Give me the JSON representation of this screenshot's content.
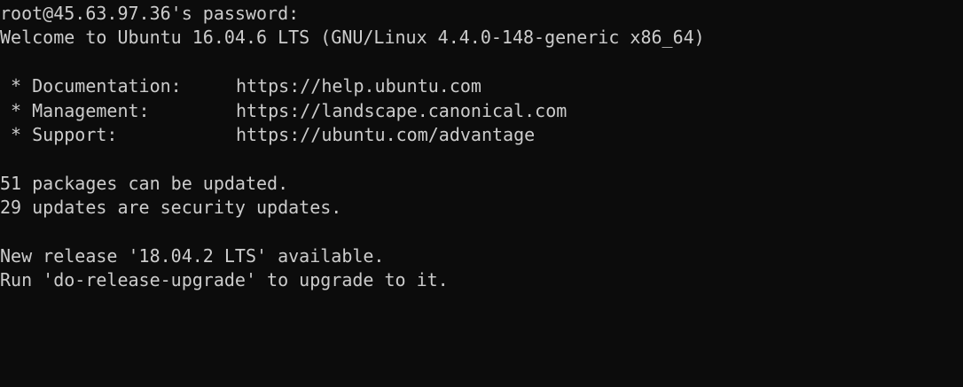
{
  "terminal": {
    "colors": {
      "background": "#0c0c0c",
      "foreground": "#cccccc"
    },
    "prompt": "root@45.63.97.36's password:",
    "welcome": "Welcome to Ubuntu 16.04.6 LTS (GNU/Linux 4.4.0-148-generic x86_64)",
    "motd_links": [
      {
        "label": " * Documentation:",
        "url": "https://help.ubuntu.com"
      },
      {
        "label": " * Management:",
        "url": "https://landscape.canonical.com"
      },
      {
        "label": " * Support:",
        "url": "https://ubuntu.com/advantage"
      }
    ],
    "updates": {
      "packages": "51 packages can be updated.",
      "security": "29 updates are security updates."
    },
    "release": {
      "available": "New release '18.04.2 LTS' available.",
      "instruction": "Run 'do-release-upgrade' to upgrade to it."
    }
  }
}
